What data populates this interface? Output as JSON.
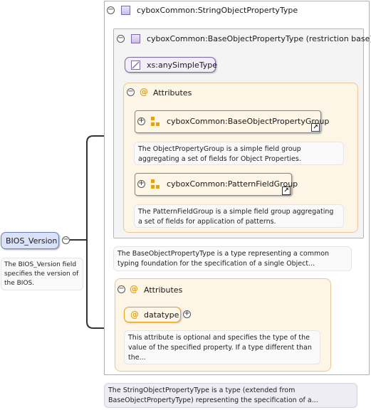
{
  "root": {
    "element_name": "BIOS_Version",
    "description": "The BIOS_Version field specifies the version of the BIOS."
  },
  "type_box": {
    "title": "cyboxCommon:StringObjectPropertyType",
    "description": "The StringObjectPropertyType is a type (extended from BaseObjectPropertyType) representing the specification of a..."
  },
  "base_box": {
    "title": "cyboxCommon:BaseObjectPropertyType (restriction base)",
    "simple_type": "xs:anySimpleType",
    "attributes_label": "Attributes",
    "groups": [
      {
        "name": "cyboxCommon:BaseObjectPropertyGroup",
        "description": "The ObjectPropertyGroup is a simple field group aggregating a set of fields for Object Properties."
      },
      {
        "name": "cyboxCommon:PatternFieldGroup",
        "description": "The PatternFieldGroup is a simple field group aggregating a set of fields for application of patterns."
      }
    ],
    "description": "The BaseObjectPropertyType is a type representing a common typing foundation for the specification of a single Object..."
  },
  "attributes_box": {
    "label": "Attributes",
    "attribute_name": "datatype",
    "attribute_description": "This attribute is optional and specifies the type of the value of the specified property. If a type different than the..."
  },
  "glyphs": {
    "collapse": "−",
    "expand": "+",
    "at": "@",
    "jump": "↗"
  },
  "colors": {
    "root_fill": "#d9e2f7",
    "root_border": "#6b82b8",
    "attr_fill": "#fdf5e6",
    "attr_border": "#e8c89a",
    "type_fill": "#f4f4f4",
    "line": "#333333"
  }
}
